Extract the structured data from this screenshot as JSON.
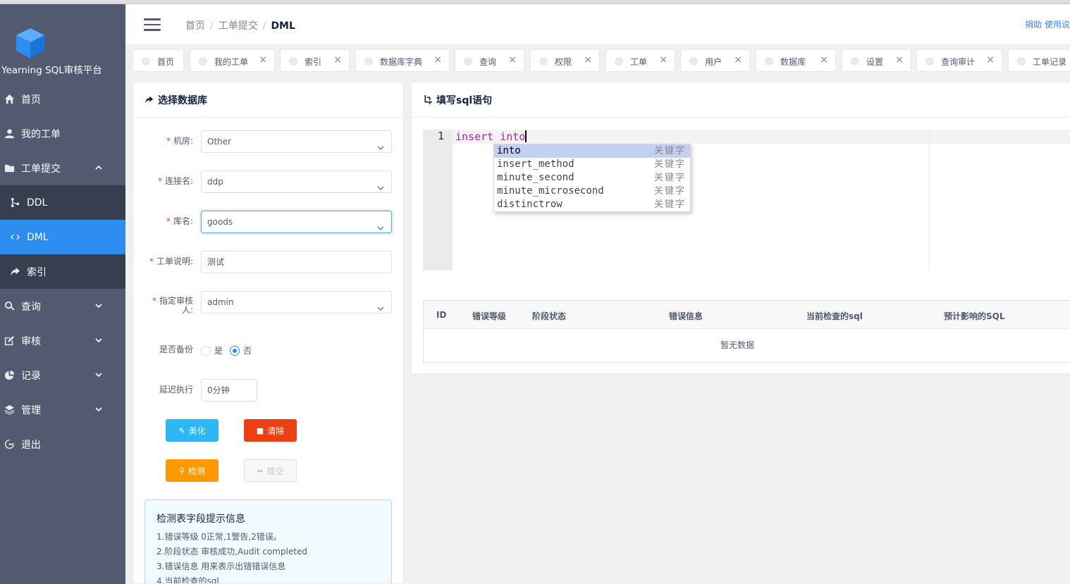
{
  "app": {
    "name": "Yearning SQL审核平台"
  },
  "sidebar": {
    "items": [
      {
        "label": "首页",
        "icon": "home-icon"
      },
      {
        "label": "我的工单",
        "icon": "person-icon"
      },
      {
        "label": "工单提交",
        "icon": "folder-icon",
        "expanded": true,
        "children": [
          {
            "label": "DDL",
            "icon": "branch-icon"
          },
          {
            "label": "DML",
            "icon": "code-icon",
            "active": true
          },
          {
            "label": "索引",
            "icon": "share-icon"
          }
        ]
      },
      {
        "label": "查询",
        "icon": "search-icon"
      },
      {
        "label": "审核",
        "icon": "edit-icon"
      },
      {
        "label": "记录",
        "icon": "pie-chart-icon"
      },
      {
        "label": "管理",
        "icon": "layers-icon"
      },
      {
        "label": "退出",
        "icon": "logout-icon"
      }
    ]
  },
  "header": {
    "breadcrumb": [
      "首页",
      "工单提交",
      "DML"
    ],
    "right_text": "捐助 使用说"
  },
  "tags": [
    "首页",
    "我的工单",
    "索引",
    "数据库字典",
    "查询",
    "权限",
    "工单",
    "用户",
    "数据库",
    "设置",
    "查询审计",
    "工单记录"
  ],
  "left_card": {
    "title": "选择数据库",
    "fields": {
      "room": {
        "label": "机房:",
        "value": "Other"
      },
      "conn": {
        "label": "连接名:",
        "value": "ddp"
      },
      "db": {
        "label": "库名:",
        "value": "goods"
      },
      "desc": {
        "label": "工单说明:",
        "value": "测试"
      },
      "auditor": {
        "label_1": "指定审核",
        "label_2": "人:",
        "value": "admin"
      },
      "backup": {
        "label": "是否备份",
        "yes": "是",
        "no": "否",
        "selected": "否"
      },
      "delay": {
        "label": "延迟执行",
        "value": "0分钟"
      }
    },
    "buttons": {
      "beautify": "美化",
      "clear": "清除",
      "check": "检测",
      "submit": "提交"
    },
    "info": {
      "title": "检测表字段提示信息",
      "lines": [
        "1.错误等级 0正常,1警告,2错误。",
        "2.阶段状态 审核成功,Audit completed",
        "3.错误信息 用来表示出错错误信息",
        "4.当前检查的sql"
      ]
    }
  },
  "right_card": {
    "title": "填写sql语句",
    "editor": {
      "line_number": "1",
      "code": "insert into",
      "autocomplete": [
        {
          "word": "into",
          "meta": "关键字"
        },
        {
          "word": "insert_method",
          "meta": "关键字"
        },
        {
          "word": "minute_second",
          "meta": "关键字"
        },
        {
          "word": "minute_microsecond",
          "meta": "关键字"
        },
        {
          "word": "distinctrow",
          "meta": "关键字"
        }
      ]
    },
    "table": {
      "columns": [
        "ID",
        "错误等级",
        "阶段状态",
        "错误信息",
        "当前检查的sql",
        "预计影响的SQL"
      ],
      "empty_text": "暂无数据"
    }
  },
  "colors": {
    "sidebar_bg": "#515a6e",
    "submenu_bg": "#363e4f",
    "active": "#2d8cf0",
    "btn_beautify": "#2db7f5",
    "btn_clear": "#ed3f14",
    "btn_check": "#ff9900"
  }
}
